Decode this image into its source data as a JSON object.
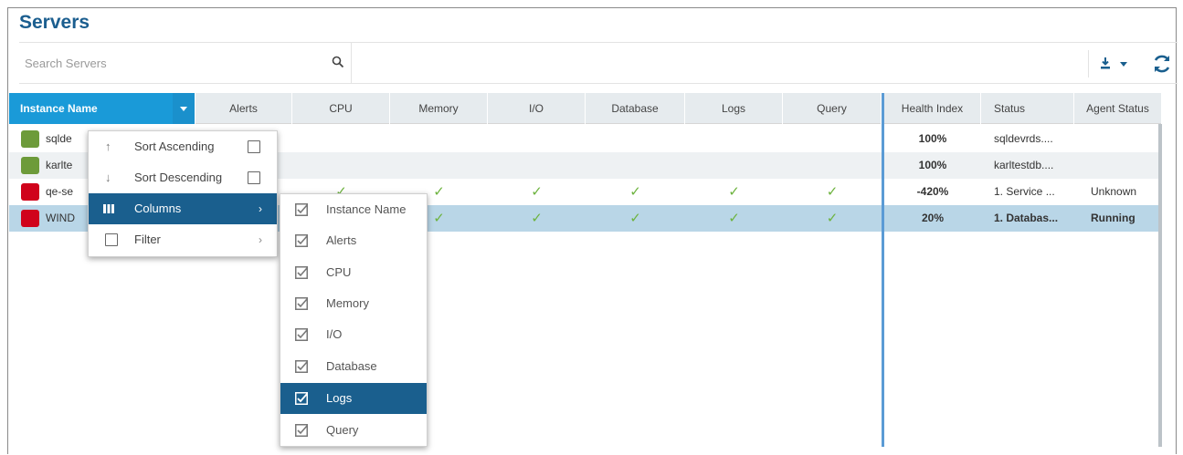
{
  "page": {
    "title": "Servers"
  },
  "search": {
    "placeholder": "Search Servers"
  },
  "grid": {
    "columns": [
      "Instance Name",
      "Alerts",
      "CPU",
      "Memory",
      "I/O",
      "Database",
      "Logs",
      "Query",
      "Health Index",
      "Status",
      "Agent Status"
    ],
    "rows": [
      {
        "name": "sqlde",
        "color": "#6d9b3a",
        "health": "100%",
        "status": "sqldevrds....",
        "agent": "",
        "checks": false
      },
      {
        "name": "karlte",
        "color": "#6d9b3a",
        "health": "100%",
        "status": "karltestdb....",
        "agent": "",
        "checks": false
      },
      {
        "name": "qe-se",
        "color": "#d0021b",
        "health": "-420%",
        "status": "1. Service ...",
        "agent": "Unknown",
        "checks": true
      },
      {
        "name": "WIND",
        "color": "#d0021b",
        "health": "20%",
        "status": "1. Databas...",
        "agent": "Running",
        "checks": true
      }
    ]
  },
  "context_menu": {
    "items": [
      {
        "label": "Sort Ascending"
      },
      {
        "label": "Sort Descending"
      },
      {
        "label": "Columns"
      },
      {
        "label": "Filter"
      }
    ]
  },
  "columns_menu": {
    "items": [
      {
        "label": "Instance Name",
        "checked": true
      },
      {
        "label": "Alerts",
        "checked": true
      },
      {
        "label": "CPU",
        "checked": true
      },
      {
        "label": "Memory",
        "checked": true
      },
      {
        "label": "I/O",
        "checked": true
      },
      {
        "label": "Database",
        "checked": true
      },
      {
        "label": "Logs",
        "checked": true
      },
      {
        "label": "Query",
        "checked": true
      }
    ]
  },
  "colors": {
    "accent": "#1a9ad8",
    "menu_active": "#1a5f8e",
    "title": "#1b5e8f",
    "check": "#6db33f",
    "selected_row": "#b9d6e7"
  }
}
